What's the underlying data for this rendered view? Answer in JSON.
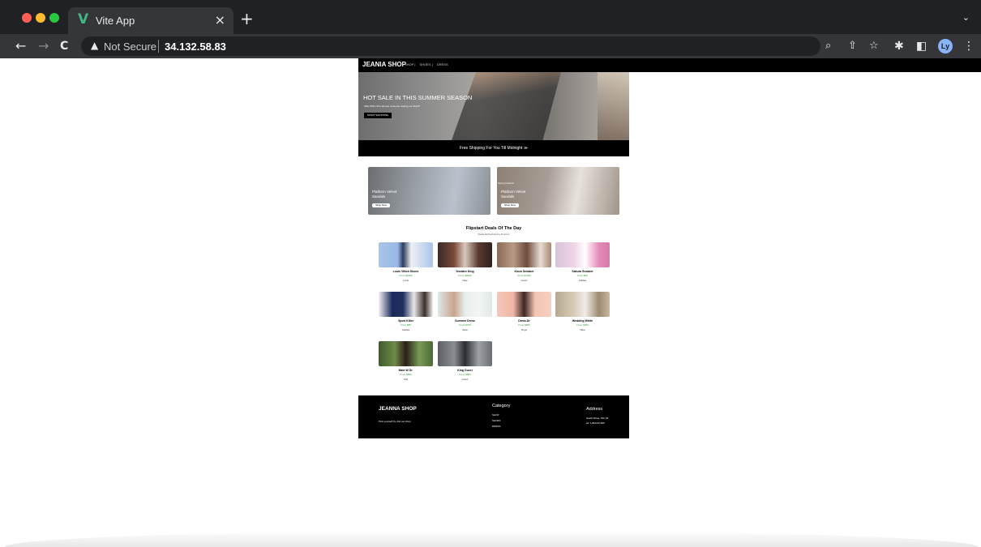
{
  "browser": {
    "tab_title": "Vite App",
    "tab_close": "×",
    "new_tab": "+",
    "tab_menu": "⌄",
    "back": "←",
    "forward": "→",
    "reload": "C",
    "security_label": "Not Secure",
    "url": "34.132.58.83",
    "profile_initials": "Ly",
    "colors": {
      "tabbar": "#202124",
      "toolbar": "#35363a",
      "red": "#ff5f57",
      "yellow": "#febc2e",
      "green": "#28c840",
      "vue_green": "#41b883"
    }
  },
  "nav": {
    "brand": "JEANIA SHOP",
    "links": [
      "SHOP |",
      "SHOES |",
      "DRESS"
    ]
  },
  "hero": {
    "title": "HOT SALE IN THIS SUMMER SEASON",
    "subtitle": "Offer 50% off to all new customer visiting our SHOP",
    "button": "START SHOPPING"
  },
  "shipping": {
    "text": "Free Shipping For You Till Midnight ≫"
  },
  "promos": [
    {
      "title_line1": "Platform Velvet",
      "title_line2": "Sandals",
      "small": "",
      "button": "Shop Now"
    },
    {
      "title_line1": "Platform Velvet",
      "title_line2": "Sandals",
      "small": "Spring Fashion",
      "button": "Shop Now"
    }
  ],
  "deals": {
    "title": "Flipstart Deals Of The Day",
    "subtitle": "Deals Refresh Every 8 Hours",
    "products": [
      {
        "name": "Louis Vitton Shoes",
        "price": "From $1000",
        "brand": "Louis"
      },
      {
        "name": "Sneaker King",
        "price": "From $2000",
        "brand": "Nike"
      },
      {
        "name": "Kinzo Sneaker",
        "price": "From $7000",
        "brand": "Gucci"
      },
      {
        "name": "Sakura Sneaker",
        "price": "From $90",
        "brand": "Adidas"
      },
      {
        "name": "Sport Killer",
        "price": "From $80",
        "brand": "Adidas"
      },
      {
        "name": "Summer Dress",
        "price": "From $700",
        "brand": "Zara"
      },
      {
        "name": "Dress.Dr",
        "price": "From $800",
        "brand": "Dngs"
      },
      {
        "name": "Wedding White",
        "price": "From $900",
        "brand": "Nike"
      },
      {
        "name": "Male W Dr.",
        "price": "From $800",
        "brand": "Kali"
      },
      {
        "name": "King Gucci",
        "price": "From $800",
        "brand": "Gucci"
      }
    ]
  },
  "footer": {
    "brand": "JEANNA SHOP",
    "tagline": "Pink yourself by visit our shop",
    "category_title": "Category",
    "categories": [
      "SHOP",
      "SHOES",
      "DRESS"
    ],
    "address_title": "Address",
    "address_line1": "South Africa, Plot 18",
    "address_line2": "tel: 1-800-00-000"
  }
}
